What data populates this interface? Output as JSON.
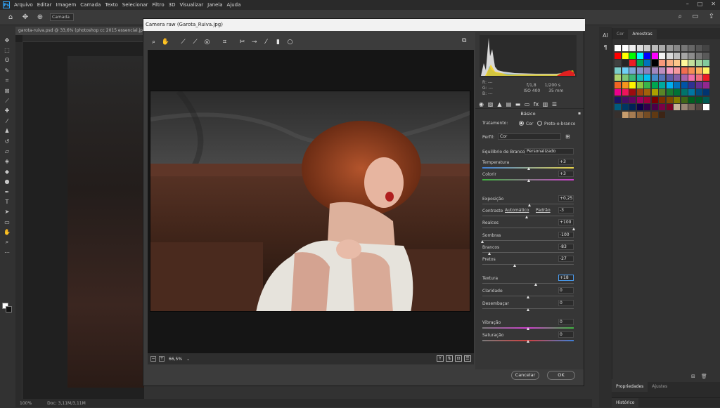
{
  "app": {
    "menu": [
      "Arquivo",
      "Editar",
      "Imagem",
      "Camada",
      "Texto",
      "Selecionar",
      "Filtro",
      "3D",
      "Visualizar",
      "Janela",
      "Ajuda"
    ],
    "options_select": "Camada",
    "doc_tab": "garota-ruiva.psd @ 33,6% (photoshop cc 2015 essencial.jpg, RGB/8)",
    "status_zoom": "100%",
    "status_doc": "Doc: 3,11M/3,11M"
  },
  "panels": {
    "swatches_tabs": [
      "Cor",
      "Amostras"
    ],
    "properties_tabs": [
      "Propriedades",
      "Ajustes"
    ],
    "history_tab": "Histórico",
    "side_labels": [
      "AI",
      "¶"
    ]
  },
  "camera_raw": {
    "title": "Camera raw (Garota_Ruiva.jpg)",
    "zoom": "66,5%",
    "rgb_labels": [
      "R:",
      "G:",
      "B:"
    ],
    "rgb_values": [
      "---",
      "---",
      "---"
    ],
    "aperture": "f/1,8",
    "shutter": "1/200 s",
    "iso": "ISO 400",
    "focal": "35 mm",
    "section_title": "Básico",
    "treatment_label": "Tratamento:",
    "treatment_color": "Cor",
    "treatment_bw": "Preto-e-branco",
    "profile_label": "Perfil:",
    "profile_value": "Cor",
    "wb_label": "Equilíbrio de Branco:",
    "wb_value": "Personalizado",
    "auto_link": "Automático",
    "default_link": "Padrão",
    "sliders": {
      "temperatura": {
        "label": "Temperatura",
        "value": "+3",
        "level": 0.51
      },
      "colorir": {
        "label": "Colorir",
        "value": "+3",
        "level": 0.51
      },
      "exposicao": {
        "label": "Exposição",
        "value": "+0,25",
        "level": 0.52
      },
      "contraste": {
        "label": "Contraste",
        "value": "-3",
        "level": 0.49
      },
      "realces": {
        "label": "Realces",
        "value": "+100",
        "level": 1.0
      },
      "sombras": {
        "label": "Sombras",
        "value": "-100",
        "level": 0.0
      },
      "brancos": {
        "label": "Brancos",
        "value": "-83",
        "level": 0.08
      },
      "pretos": {
        "label": "Pretos",
        "value": "-27",
        "level": 0.36
      },
      "textura": {
        "label": "Textura",
        "value": "+18",
        "level": 0.59
      },
      "claridade": {
        "label": "Claridade",
        "value": "0",
        "level": 0.5
      },
      "desembacar": {
        "label": "Desembaçar",
        "value": "0",
        "level": 0.5
      },
      "vibracao": {
        "label": "Vibração",
        "value": "0",
        "level": 0.5
      },
      "saturacao": {
        "label": "Saturação",
        "value": "0",
        "level": 0.5
      }
    },
    "cancel_label": "Cancelar",
    "ok_label": "OK"
  }
}
